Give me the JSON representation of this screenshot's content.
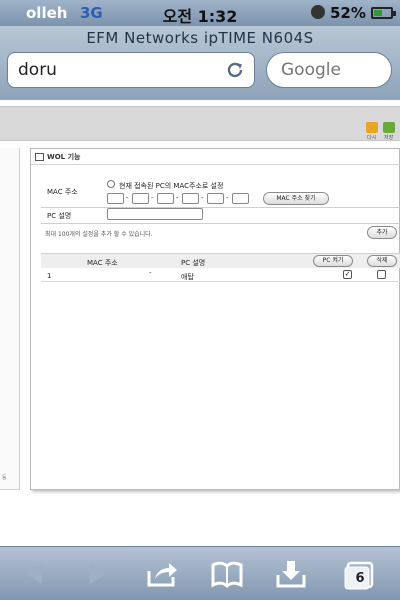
{
  "status_bar": {
    "carrier": "olleh",
    "network": "3G",
    "time": "오전 1:32",
    "battery_percent": "52%",
    "battery_level": 0.52
  },
  "browser": {
    "page_title": "EFM Networks ipTIME N604S",
    "url": "doru",
    "search_placeholder": "Google"
  },
  "header_icons": [
    {
      "label": "다시",
      "color": "#e8a526"
    },
    {
      "label": "저장",
      "color": "#6aa83a"
    }
  ],
  "wol": {
    "title": "WOL 기능",
    "mac_label": "MAC 주소",
    "radio_label": "현재 접속된 PC의 MAC주소로 설정",
    "find_mac_button": "MAC 주소 찾기",
    "pc_name_label": "PC 설명",
    "hint": "최대 100개의 설정을 추가 할 수 있습니다.",
    "add_button": "추가",
    "table": {
      "columns": [
        "MAC 주소",
        "PC 설명"
      ],
      "wake_button": "PC 켜기",
      "delete_button": "삭제",
      "rows": [
        {
          "index": "1",
          "mac": "-",
          "pc_name": "애탑",
          "wake_checked": true,
          "delete_checked": false
        }
      ]
    }
  },
  "left_panel_fragment": "등",
  "toolbar": {
    "buttons": [
      "back-icon",
      "forward-icon",
      "share-icon",
      "bookmarks-icon",
      "download-icon",
      "tabs-icon"
    ],
    "tab_count": "6"
  }
}
